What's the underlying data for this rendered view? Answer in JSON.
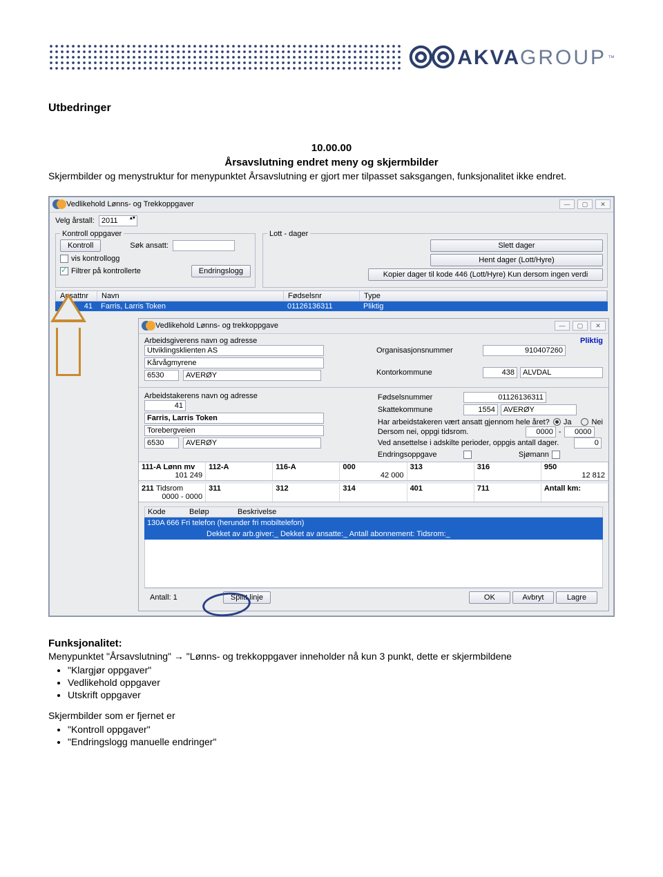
{
  "header": {
    "logo_brand": "AKVA",
    "logo_sub": "GROUP"
  },
  "doc": {
    "main_heading": "Utbedringer",
    "section_number": "10.00.00",
    "section_title": "Årsavslutning endret meny og skjermbilder",
    "description": "Skjermbilder og menystruktur for menypunktet Årsavslutning er gjort mer tilpasset saksgangen, funksjonalitet ikke endret.",
    "funk_heading": "Funksjonalitet:",
    "funk_text": "Menypunktet \"Årsavslutning\" → \"Lønns- og trekkoppgaver inneholder nå kun 3 punkt, dette er skjermbildene",
    "funk_bullets": [
      "\"Klargjør oppgaver\"",
      "Vedlikehold oppgaver",
      "Utskrift oppgaver"
    ],
    "removed_heading": "Skjermbilder som er fjernet er",
    "removed_bullets": [
      "\"Kontroll oppgaver\"",
      "\"Endringslogg manuelle endringer\""
    ]
  },
  "win1": {
    "title": "Vedlikehold Lønns- og Trekkoppgaver",
    "year_label": "Velg årstall:",
    "year_value": "2011",
    "group_kontroll": "Kontroll oppgaver",
    "btn_kontroll": "Kontroll",
    "sok_label": "Søk ansatt:",
    "btn_endringslogg": "Endringslogg",
    "chk_vis": "vis kontrollogg",
    "chk_filtrer": "Filtrer på kontrollerte",
    "group_lott": "Lott - dager",
    "btn_slettdager": "Slett dager",
    "btn_hentdager": "Hent dager (Lott/Hyre)",
    "btn_kopier": "Kopier dager til kode 446 (Lott/Hyre) Kun dersom ingen verdi",
    "cols": {
      "ansattnr": "Ansattnr",
      "navn": "Navn",
      "fodselsnr": "Fødselsnr",
      "type": "Type"
    },
    "row": {
      "ansattnr": "41",
      "navn": "Farris, Larris Token",
      "fodselsnr": "01126136311",
      "type": "Pliktig"
    }
  },
  "win2": {
    "title": "Vedlikehold Lønns- og trekkoppgave",
    "emp_section": "Arbeidsgiverens navn og adresse",
    "employer_name": "Utviklingsklienten AS",
    "employer_addr": "Kårvågmyrene",
    "employer_zip": "6530",
    "employer_city": "AVERØY",
    "orgnr_label": "Organisasjonsnummer",
    "orgnr": "910407260",
    "kontor_label": "Kontorkommune",
    "kontor_nr": "438",
    "kontor_name": "ALVDAL",
    "pliktig": "Pliktig",
    "worker_section": "Arbeidstakerens navn og adresse",
    "worker_nr": "41",
    "worker_name": "Farris, Larris Token",
    "worker_addr": "Torebergveien",
    "worker_zip": "6530",
    "worker_city": "AVERØY",
    "fnr_label": "Fødselsnummer",
    "fnr": "01126136311",
    "skatt_label": "Skattekommune",
    "skatt_nr": "1554",
    "skatt_name": "AVERØY",
    "q_whole_year": "Har arbeidstakeren vært ansatt gjennom hele året?",
    "ja": "Ja",
    "nei": "Nei",
    "q_tidsrom": "Dersom nei, oppgi tidsrom.",
    "tids1": "0000",
    "tids2": "0000",
    "q_antall": "Ved ansettelse i adskilte perioder, oppgis antall dager.",
    "antall_dager": "0",
    "endringsoppg": "Endringsoppgave",
    "sjomann": "Sjømann",
    "sumrow1": [
      {
        "head": "111-A Lønn mv",
        "val": "101 249"
      },
      {
        "head": "112-A",
        "val": ""
      },
      {
        "head": "116-A",
        "val": ""
      },
      {
        "head": "000",
        "val": "42 000"
      },
      {
        "head": "313",
        "val": ""
      },
      {
        "head": "316",
        "val": ""
      },
      {
        "head": "950",
        "val": "12 812"
      }
    ],
    "sumrow2": [
      {
        "head": "211",
        "sub": "Tidsrom",
        "val": "0000 - 0000"
      },
      {
        "head": "311",
        "val": ""
      },
      {
        "head": "312",
        "val": ""
      },
      {
        "head": "314",
        "val": ""
      },
      {
        "head": "401",
        "val": ""
      },
      {
        "head": "711",
        "val": ""
      },
      {
        "head": "Antall km:",
        "val": ""
      }
    ],
    "det_cols": {
      "kode": "Kode",
      "belop": "Beløp",
      "besk": "Beskrivelse"
    },
    "det_row1": "130A        666 Fri telefon (herunder fri mobiltelefon)",
    "det_row2": "Dekket av arb.giver:_  Dekket av ansatte:_  Antall abonnement:  Tidsrom:_",
    "antall_label": "Antall:",
    "antall_value": "1",
    "btn_split": "Splitt linje",
    "btn_ok": "OK",
    "btn_avbryt": "Avbryt",
    "btn_lagre": "Lagre"
  }
}
